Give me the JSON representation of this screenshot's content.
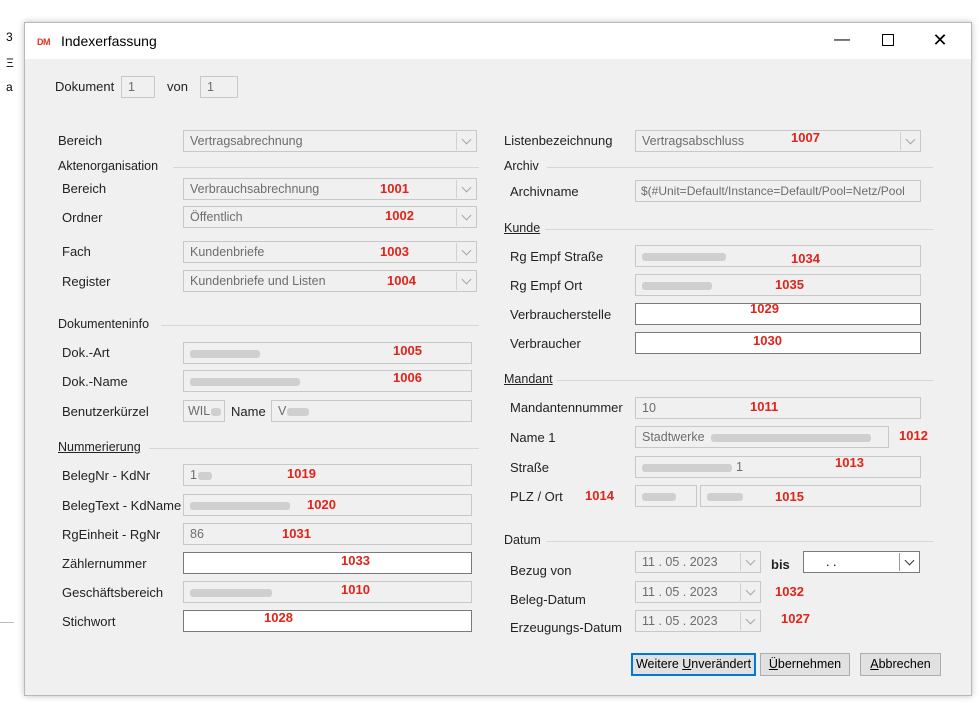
{
  "window": {
    "title": "Indexerfassung",
    "logo": "DM"
  },
  "doc": {
    "label": "Dokument",
    "value": "1",
    "von_label": "von",
    "von_value": "1"
  },
  "bereich": {
    "label": "Bereich",
    "value": "Vertragsabrechnung"
  },
  "akten": {
    "title": "Aktenorganisation",
    "bereich": {
      "label": "Bereich",
      "value": "Verbrauchsabrechnung",
      "code": "1001"
    },
    "ordner": {
      "label": "Ordner",
      "value": "Öffentlich",
      "code": "1002"
    },
    "fach": {
      "label": "Fach",
      "value": "Kundenbriefe",
      "code": "1003"
    },
    "register": {
      "label": "Register",
      "value": "Kundenbriefe und Listen",
      "code": "1004"
    }
  },
  "dokinfo": {
    "title": "Dokumenteninfo",
    "dokart": {
      "label": "Dok.-Art",
      "code": "1005"
    },
    "dokname": {
      "label": "Dok.-Name",
      "code": "1006"
    },
    "benutzer": {
      "label": "Benutzerkürzel",
      "value": "WIL",
      "name_label": "Name",
      "name_value": "V"
    }
  },
  "nummer": {
    "title": "Nummerierung",
    "belegnr": {
      "label": "BelegNr - KdNr",
      "value": "1",
      "code": "1019"
    },
    "belegtext": {
      "label": "BelegText - KdName",
      "code": "1020"
    },
    "rgeinheit": {
      "label": "RgEinheit - RgNr",
      "value": "86",
      "code": "1031"
    },
    "zaehler": {
      "label": "Zählernummer",
      "code": "1033"
    },
    "geschaeft": {
      "label": "Geschäftsbereich",
      "code": "1010"
    },
    "stichwort": {
      "label": "Stichwort",
      "code": "1028"
    }
  },
  "liste": {
    "label": "Listenbezeichnung",
    "value": "Vertragsabschluss",
    "code": "1007"
  },
  "archiv": {
    "title": "Archiv",
    "label": "Archivname",
    "value": "$(#Unit=Default/Instance=Default/Pool=Netz/Pool"
  },
  "kunde": {
    "title": "Kunde",
    "strasse": {
      "label": "Rg Empf Straße",
      "code": "1034"
    },
    "ort": {
      "label": "Rg Empf Ort",
      "code": "1035"
    },
    "vstelle": {
      "label": "Verbraucherstelle",
      "code": "1029"
    },
    "verbraucher": {
      "label": "Verbraucher",
      "code": "1030"
    }
  },
  "mandant": {
    "title": "Mandant",
    "nummer": {
      "label": "Mandantennummer",
      "value": "10",
      "code": "1011"
    },
    "name1": {
      "label": "Name 1",
      "value": "Stadtwerke",
      "code": "1012"
    },
    "strasse": {
      "label": "Straße",
      "value": "1",
      "code": "1013"
    },
    "plzort": {
      "label": "PLZ / Ort",
      "code_plz": "1014",
      "code_ort": "1015"
    }
  },
  "datum": {
    "title": "Datum",
    "bezug": {
      "label": "Bezug von",
      "value": "11 . 05 . 2023",
      "bis_label": "bis",
      "bis_value": ".   ."
    },
    "beleg": {
      "label": "Beleg-Datum",
      "value": "11 . 05 . 2023",
      "code": "1032"
    },
    "erzeugung": {
      "label": "Erzeugungs-Datum",
      "value": "11 . 05 . 2023",
      "code": "1027"
    }
  },
  "buttons": {
    "weitere_pre": "Weitere ",
    "weitere_u": "U",
    "weitere_post": "nverändert",
    "ueber_u": "Ü",
    "ueber_post": "bernehmen",
    "abbr_u": "A",
    "abbr_post": "bbrechen"
  },
  "edge": {
    "c1": "3",
    "c2": "Ξ",
    "c3": "a"
  }
}
